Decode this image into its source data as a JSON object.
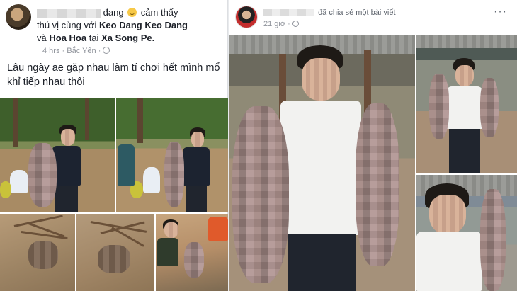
{
  "left_post": {
    "header": {
      "feeling_word": "đang",
      "feeling_text": "cảm thấy",
      "line2_prefix": "thú vị cùng với",
      "tagged_1": "Keo Dang Keo Dang",
      "and_word": "và",
      "tagged_2": "Hoa Hoa",
      "at_word": "tại",
      "place": "Xa Song Pe.",
      "time": "4 hrs",
      "location": "Bắc Yên",
      "separator": "·"
    },
    "body_text": "Lâu ngày ae gặp nhau làm tí chơi hết mình mổ khỉ tiếp nhau thôi"
  },
  "right_post": {
    "header": {
      "action_text": "đã chia sẻ một bài viết",
      "time": "21 giờ",
      "separator": "·"
    }
  },
  "icons": {
    "smiley": "smiley-emoji-icon",
    "globe": "globe-icon",
    "more": "more-options-icon"
  },
  "colors": {
    "page_bg": "#e9ebee",
    "text": "#1d2129",
    "meta": "#90949c"
  }
}
